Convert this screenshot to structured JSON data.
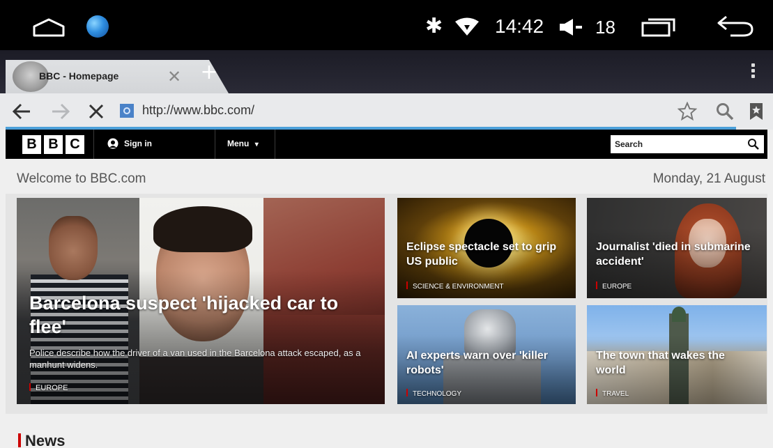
{
  "status_bar": {
    "time": "14:42",
    "volume": "18",
    "icons": [
      "home-outline-icon",
      "browser-globe-icon",
      "bluetooth-icon",
      "wifi-icon",
      "volume-icon",
      "recent-apps-icon",
      "back-icon"
    ]
  },
  "browser": {
    "tab": {
      "title": "BBC - Homepage"
    },
    "new_tab": "+",
    "url": "http://www.bbc.com/",
    "progress_color": "#4b9fd9"
  },
  "bbc": {
    "logo": [
      "B",
      "B",
      "C"
    ],
    "nav": {
      "sign_in": "Sign in",
      "menu": "Menu",
      "search_placeholder": "Search"
    },
    "welcome": "Welcome to BBC.com",
    "date": "Monday, 21 August",
    "hero": {
      "title": "Barcelona suspect 'hijacked car to flee'",
      "summary": "Police describe how the driver of a van used in the Barcelona attack escaped, as a manhunt widens.",
      "tag": "EUROPE"
    },
    "stories": [
      {
        "title": "Eclipse spectacle set to grip US public",
        "tag": "SCIENCE & ENVIRONMENT"
      },
      {
        "title": "Journalist 'died in submarine accident'",
        "tag": "EUROPE"
      },
      {
        "title": "AI experts warn over 'killer robots'",
        "tag": "TECHNOLOGY"
      },
      {
        "title": "The town that wakes the world",
        "tag": "TRAVEL"
      }
    ],
    "section_heading": "News",
    "accent_color": "#cc0000"
  }
}
